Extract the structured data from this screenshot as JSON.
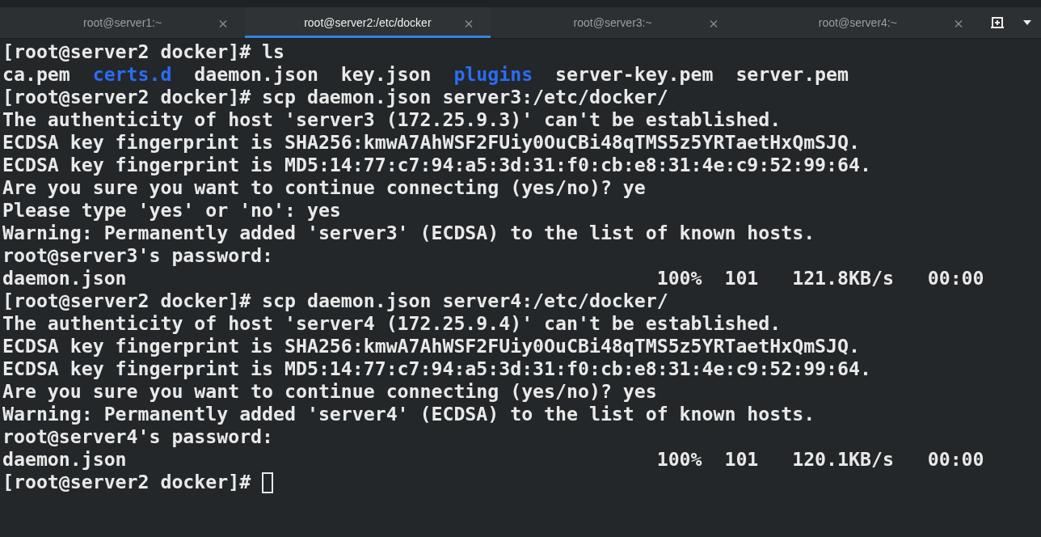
{
  "tabs": [
    {
      "label": "root@server1:~",
      "selected": false
    },
    {
      "label": "root@server2:/etc/docker",
      "selected": true
    },
    {
      "label": "root@server3:~",
      "selected": false
    },
    {
      "label": "root@server4:~",
      "selected": false
    }
  ],
  "terminal": {
    "lines": [
      {
        "kind": "text",
        "text": "[root@server2 docker]# ls"
      },
      {
        "kind": "listing",
        "entries": [
          {
            "text": "ca.pem",
            "kind": "file"
          },
          {
            "text": "certs.d",
            "kind": "dir"
          },
          {
            "text": "daemon.json",
            "kind": "file"
          },
          {
            "text": "key.json",
            "kind": "file"
          },
          {
            "text": "plugins",
            "kind": "dir"
          },
          {
            "text": "server-key.pem",
            "kind": "file"
          },
          {
            "text": "server.pem",
            "kind": "file"
          }
        ]
      },
      {
        "kind": "text",
        "text": "[root@server2 docker]# scp daemon.json server3:/etc/docker/"
      },
      {
        "kind": "text",
        "text": "The authenticity of host 'server3 (172.25.9.3)' can't be established."
      },
      {
        "kind": "text",
        "text": "ECDSA key fingerprint is SHA256:kmwA7AhWSF2FUiy0OuCBi48qTMS5z5YRTaetHxQmSJQ."
      },
      {
        "kind": "text",
        "text": "ECDSA key fingerprint is MD5:14:77:c7:94:a5:3d:31:f0:cb:e8:31:4e:c9:52:99:64."
      },
      {
        "kind": "text",
        "text": "Are you sure you want to continue connecting (yes/no)? ye"
      },
      {
        "kind": "text",
        "text": "Please type 'yes' or 'no': yes"
      },
      {
        "kind": "text",
        "text": "Warning: Permanently added 'server3' (ECDSA) to the list of known hosts."
      },
      {
        "kind": "text",
        "text": "root@server3's password:"
      },
      {
        "kind": "text",
        "text": "daemon.json                                               100%  101   121.8KB/s   00:00"
      },
      {
        "kind": "text",
        "text": "[root@server2 docker]# scp daemon.json server4:/etc/docker/"
      },
      {
        "kind": "text",
        "text": "The authenticity of host 'server4 (172.25.9.4)' can't be established."
      },
      {
        "kind": "text",
        "text": "ECDSA key fingerprint is SHA256:kmwA7AhWSF2FUiy0OuCBi48qTMS5z5YRTaetHxQmSJQ."
      },
      {
        "kind": "text",
        "text": "ECDSA key fingerprint is MD5:14:77:c7:94:a5:3d:31:f0:cb:e8:31:4e:c9:52:99:64."
      },
      {
        "kind": "text",
        "text": "Are you sure you want to continue connecting (yes/no)? yes"
      },
      {
        "kind": "text",
        "text": "Warning: Permanently added 'server4' (ECDSA) to the list of known hosts."
      },
      {
        "kind": "text",
        "text": "root@server4's password:"
      },
      {
        "kind": "text",
        "text": "daemon.json                                               100%  101   120.1KB/s   00:00"
      },
      {
        "kind": "prompt",
        "text": "[root@server2 docker]#",
        "cursor": true
      }
    ]
  }
}
